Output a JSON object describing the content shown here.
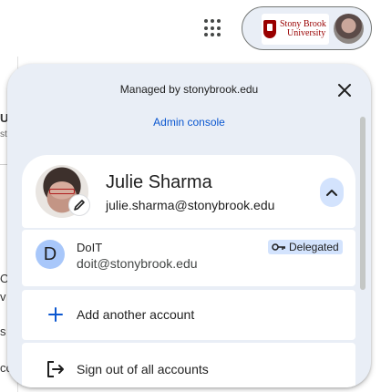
{
  "popup": {
    "managed_text": "Managed by stonybrook.edu",
    "admin_console": "Admin console"
  },
  "account_chip": {
    "logo_line1": "Stony Brook",
    "logo_line2": "University"
  },
  "primary_account": {
    "name": "Julie Sharma",
    "email": "julie.sharma@stonybrook.edu"
  },
  "delegated_account": {
    "initial": "D",
    "name": "DoIT",
    "email": "doit@stonybrook.edu",
    "badge": "Delegated"
  },
  "actions": {
    "add_account": "Add another account",
    "sign_out": "Sign out of all accounts"
  },
  "background_fragments": [
    "Up",
    "sta",
    "ON",
    "v",
    "s",
    "cc"
  ],
  "colors": {
    "popup_bg": "#e9eef6",
    "accent_blue": "#0b57d0",
    "avatar_d": "#a8c7fa",
    "badge_bg": "#d3e3fd",
    "brand_red": "#990000"
  },
  "icons": [
    "apps-grid-icon",
    "close-icon",
    "edit-pencil-icon",
    "chevron-up-icon",
    "key-icon",
    "plus-icon",
    "sign-out-icon"
  ]
}
